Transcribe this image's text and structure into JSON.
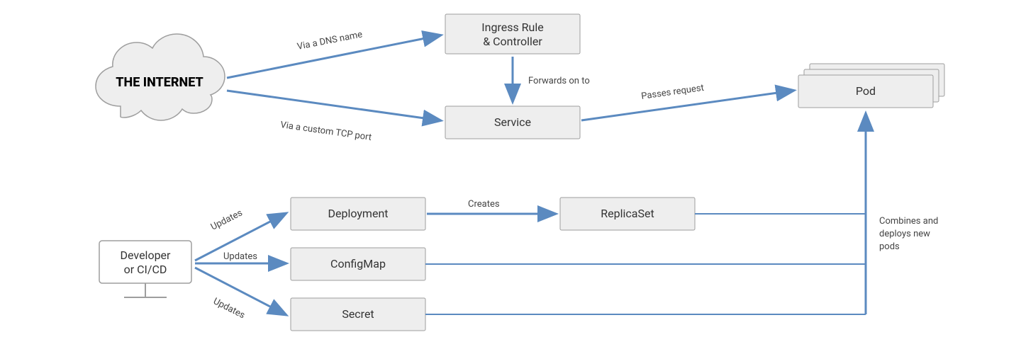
{
  "nodes": {
    "internet": "THE INTERNET",
    "ingress_line1": "Ingress Rule",
    "ingress_line2": "& Controller",
    "service": "Service",
    "pod": "Pod",
    "developer_line1": "Developer",
    "developer_line2": "or CI/CD",
    "deployment": "Deployment",
    "configmap": "ConfigMap",
    "secret": "Secret",
    "replicaset": "ReplicaSet"
  },
  "edges": {
    "dns": "Via a DNS name",
    "tcp": "Via a custom TCP port",
    "forwards": "Forwards on to",
    "passes": "Passes request",
    "updates1": "Updates",
    "updates2": "Updates",
    "updates3": "Updates",
    "creates": "Creates",
    "combines_line1": "Combines and",
    "combines_line2": "deploys new",
    "combines_line3": "pods"
  }
}
